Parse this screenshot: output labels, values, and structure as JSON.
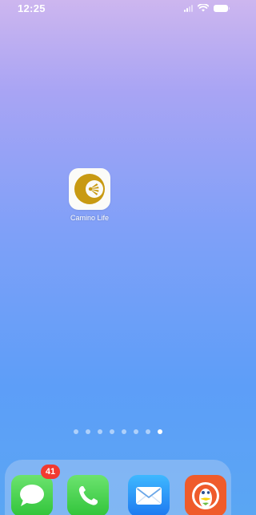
{
  "status_bar": {
    "time": "12:25"
  },
  "home": {
    "apps": [
      {
        "label": "Camino Life",
        "icon": "camino-shell-icon",
        "brand_color": "#c89a12"
      }
    ],
    "page_dots": {
      "count": 8,
      "active_index": 7
    }
  },
  "dock": {
    "apps": [
      {
        "name": "Messages",
        "icon": "messages-icon",
        "badge": "41"
      },
      {
        "name": "Phone",
        "icon": "phone-icon"
      },
      {
        "name": "Mail",
        "icon": "mail-icon"
      },
      {
        "name": "DuckDuckGo",
        "icon": "duckduckgo-icon"
      }
    ]
  },
  "colors": {
    "badge": "#f23a30",
    "messages_green": "#31c43a",
    "mail_blue": "#1d79f0",
    "duckduckgo_orange": "#ef5b2b"
  }
}
